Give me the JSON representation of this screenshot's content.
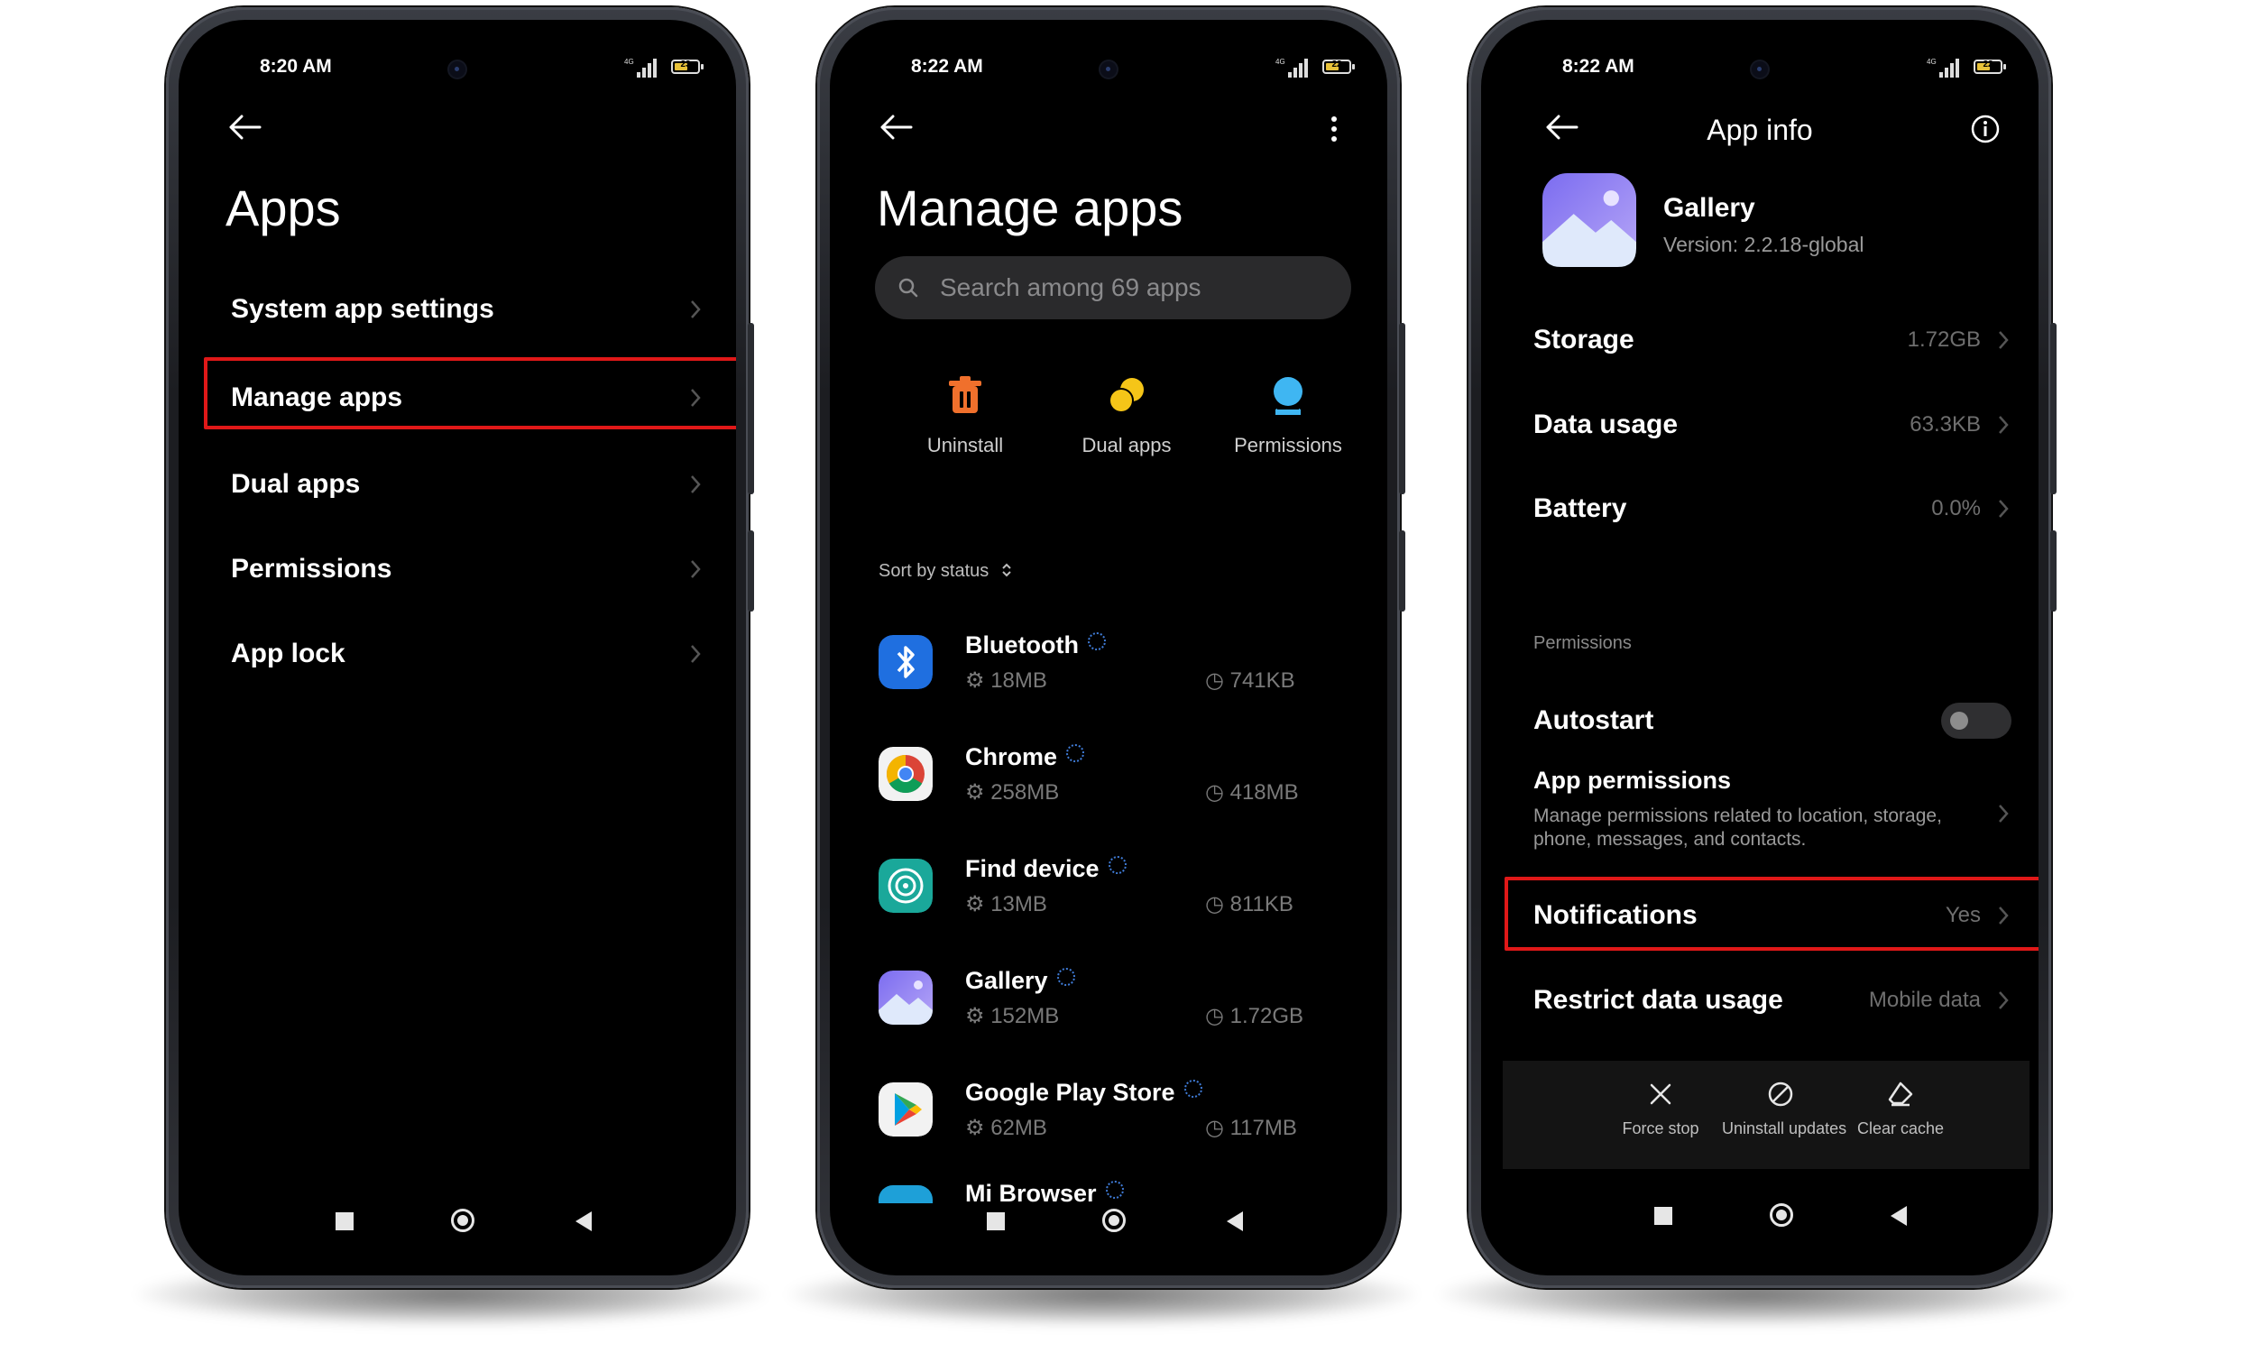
{
  "phone1": {
    "status": {
      "time": "8:20 AM",
      "battery": "23"
    },
    "title": "Apps",
    "items": [
      {
        "label": "System app settings"
      },
      {
        "label": "Manage apps",
        "highlighted": true
      },
      {
        "label": "Dual apps"
      },
      {
        "label": "Permissions"
      },
      {
        "label": "App lock"
      }
    ]
  },
  "phone2": {
    "status": {
      "time": "8:22 AM",
      "battery": "22"
    },
    "title": "Manage apps",
    "search": {
      "placeholder": "Search among 69 apps"
    },
    "quick_actions": [
      {
        "label": "Uninstall",
        "icon": "trash-icon",
        "color": "#f0702c"
      },
      {
        "label": "Dual apps",
        "icon": "dual-circles-icon",
        "color": "#f5c518"
      },
      {
        "label": "Permissions",
        "icon": "permissions-icon",
        "color": "#3fb6f2"
      }
    ],
    "sort": {
      "label": "Sort by status"
    },
    "apps": [
      {
        "name": "Bluetooth",
        "size": "18MB",
        "data": "741KB",
        "icon": "bluetooth-icon"
      },
      {
        "name": "Chrome",
        "size": "258MB",
        "data": "418MB",
        "icon": "chrome-icon"
      },
      {
        "name": "Find device",
        "size": "13MB",
        "data": "811KB",
        "icon": "find-device-icon"
      },
      {
        "name": "Gallery",
        "size": "152MB",
        "data": "1.72GB",
        "icon": "gallery-icon"
      },
      {
        "name": "Google Play Store",
        "size": "62MB",
        "data": "117MB",
        "icon": "play-store-icon"
      },
      {
        "name": "Mi Browser",
        "size": "",
        "data": "",
        "icon": "mi-browser-icon"
      }
    ]
  },
  "phone3": {
    "status": {
      "time": "8:22 AM",
      "battery": "22"
    },
    "title": "App info",
    "app": {
      "name": "Gallery",
      "version": "Version: 2.2.18-global"
    },
    "rows": [
      {
        "label": "Storage",
        "value": "1.72GB"
      },
      {
        "label": "Data usage",
        "value": "63.3KB"
      },
      {
        "label": "Battery",
        "value": "0.0%"
      }
    ],
    "permissions_section": "Permissions",
    "autostart": {
      "label": "Autostart",
      "enabled": false
    },
    "app_permissions": {
      "label": "App permissions",
      "description": "Manage permissions related to location, storage, phone, messages, and contacts."
    },
    "notifications": {
      "label": "Notifications",
      "value": "Yes"
    },
    "restrict": {
      "label": "Restrict data usage",
      "value": "Mobile data"
    },
    "actions": [
      {
        "label": "Force stop",
        "icon": "close-icon"
      },
      {
        "label": "Uninstall updates",
        "icon": "block-icon"
      },
      {
        "label": "Clear cache",
        "icon": "eraser-icon"
      }
    ]
  },
  "colors": {
    "highlight": "#e01818",
    "background": "#000000"
  }
}
